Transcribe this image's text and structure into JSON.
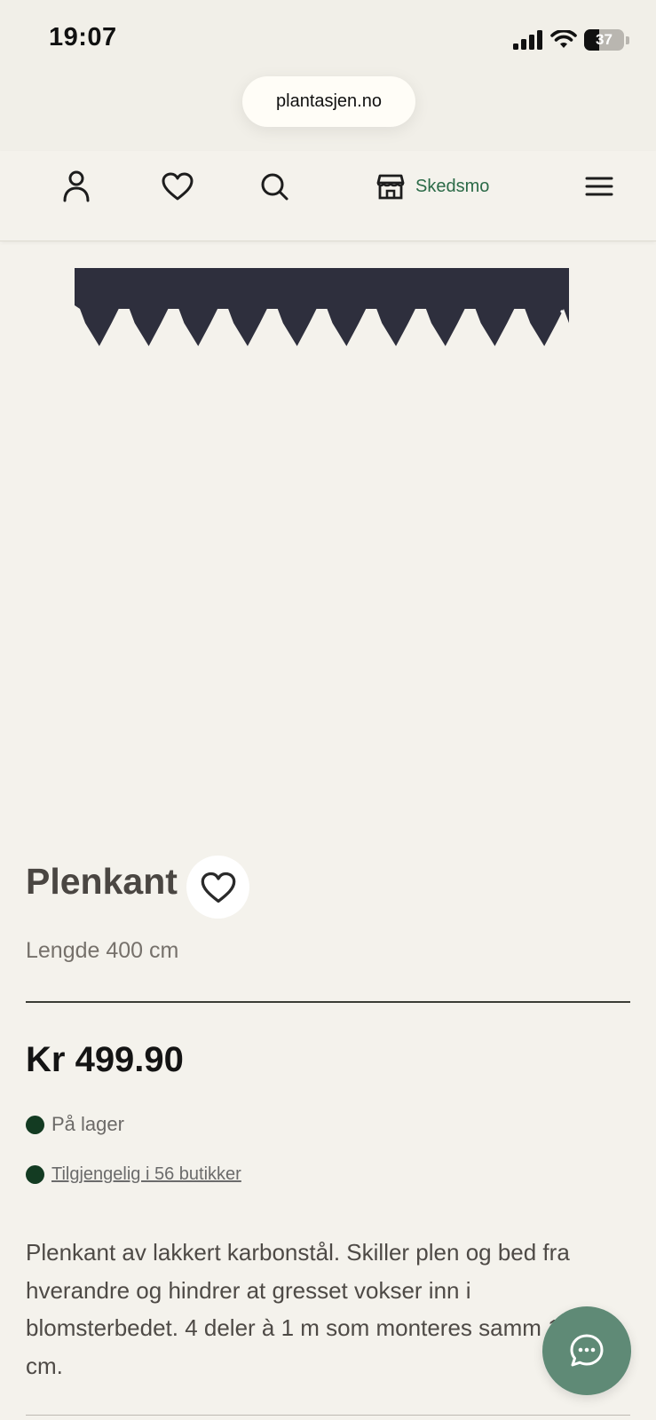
{
  "status_bar": {
    "time": "19:07",
    "battery_percent": "37",
    "battery_level": 0.37
  },
  "browser": {
    "url": "plantasjen.no"
  },
  "header": {
    "icons": [
      "user-icon",
      "heart-icon",
      "search-icon",
      "store-icon",
      "menu-icon"
    ],
    "store_name": "Skedsmo",
    "store_color": "#2b6a47"
  },
  "product": {
    "title": "Plenkant",
    "subtitle": "Lengde 400 cm",
    "price": "Kr 499.90",
    "stock_status": "På lager",
    "availability_link": "Tilgjengelig i 56 butikker",
    "description": "Plenkant av lakkert karbonstål. Skiller plen og bed fra hverandre og hindrer at gresset vokser inn i blomsterbedet. 4 deler à 1 m som monteres samm 17 cm."
  },
  "colors": {
    "background": "#f4f2ec",
    "stock_dot": "#133b22",
    "chat_button": "#5f8a76"
  }
}
